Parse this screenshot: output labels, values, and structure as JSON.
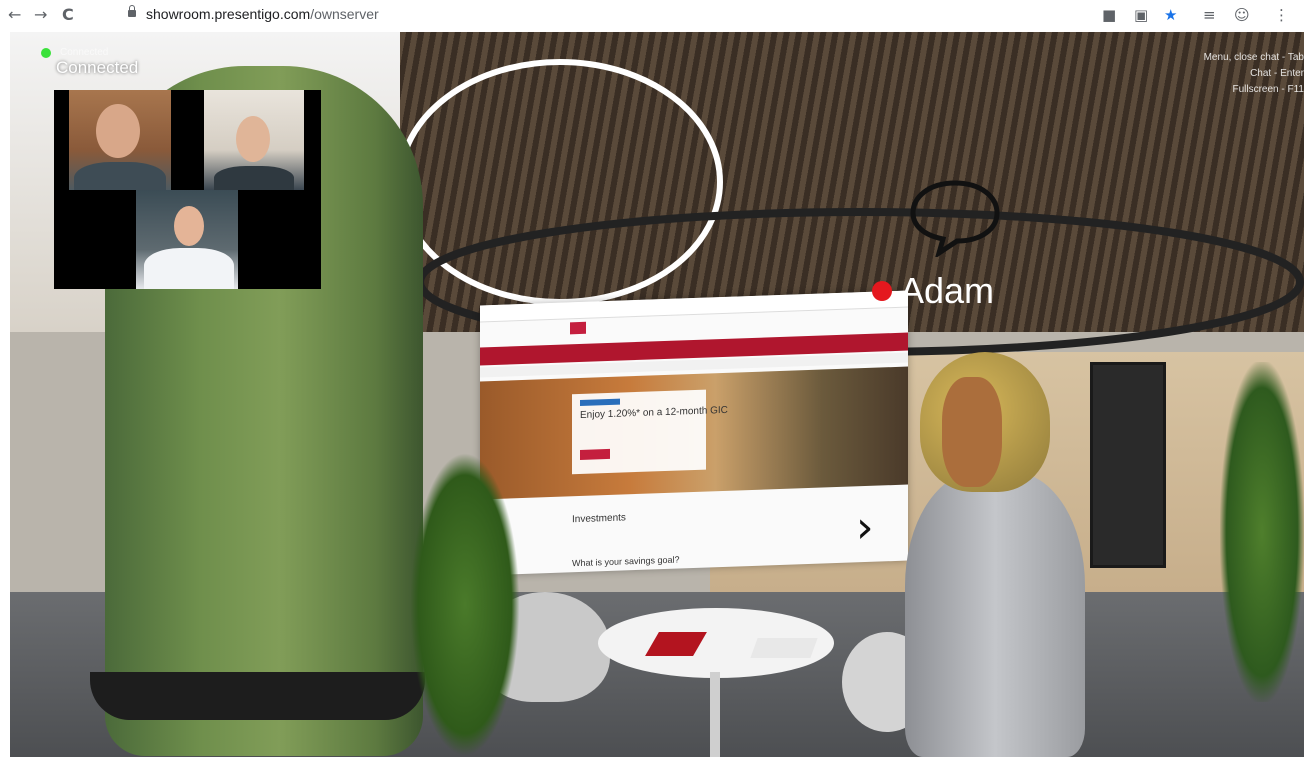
{
  "browser": {
    "nav": {
      "back": "←",
      "forward": "→",
      "reload": "C"
    },
    "url": {
      "host": "showroom.presentigo.com",
      "path": "/ownserver"
    },
    "extensions": [
      "camera-icon",
      "translate-icon",
      "star-icon",
      "queue-icon",
      "account-icon",
      "more-icon"
    ],
    "extension_glyphs": {
      "camera": "■",
      "translate": "▣",
      "star": "★",
      "queue": "≡",
      "account": "☺",
      "more": "⋮"
    },
    "star_color": "#1a73e8"
  },
  "hud": {
    "status_small": "Connected",
    "status_big": "Connected",
    "status_color": "#3ae13a",
    "hints": [
      "Menu, close chat - Tab",
      "Chat - Enter",
      "Fullscreen - F11"
    ]
  },
  "call": {
    "participants": 3
  },
  "avatar": {
    "name": "Adam",
    "indicator_color": "#e4181e"
  },
  "screen": {
    "hero_text": "Enjoy 1.20%* on a 12-month GIC",
    "section_title": "Investments",
    "question": "What is your savings goal?",
    "next_icon": "chevron-right-icon",
    "next_glyph": "›"
  }
}
